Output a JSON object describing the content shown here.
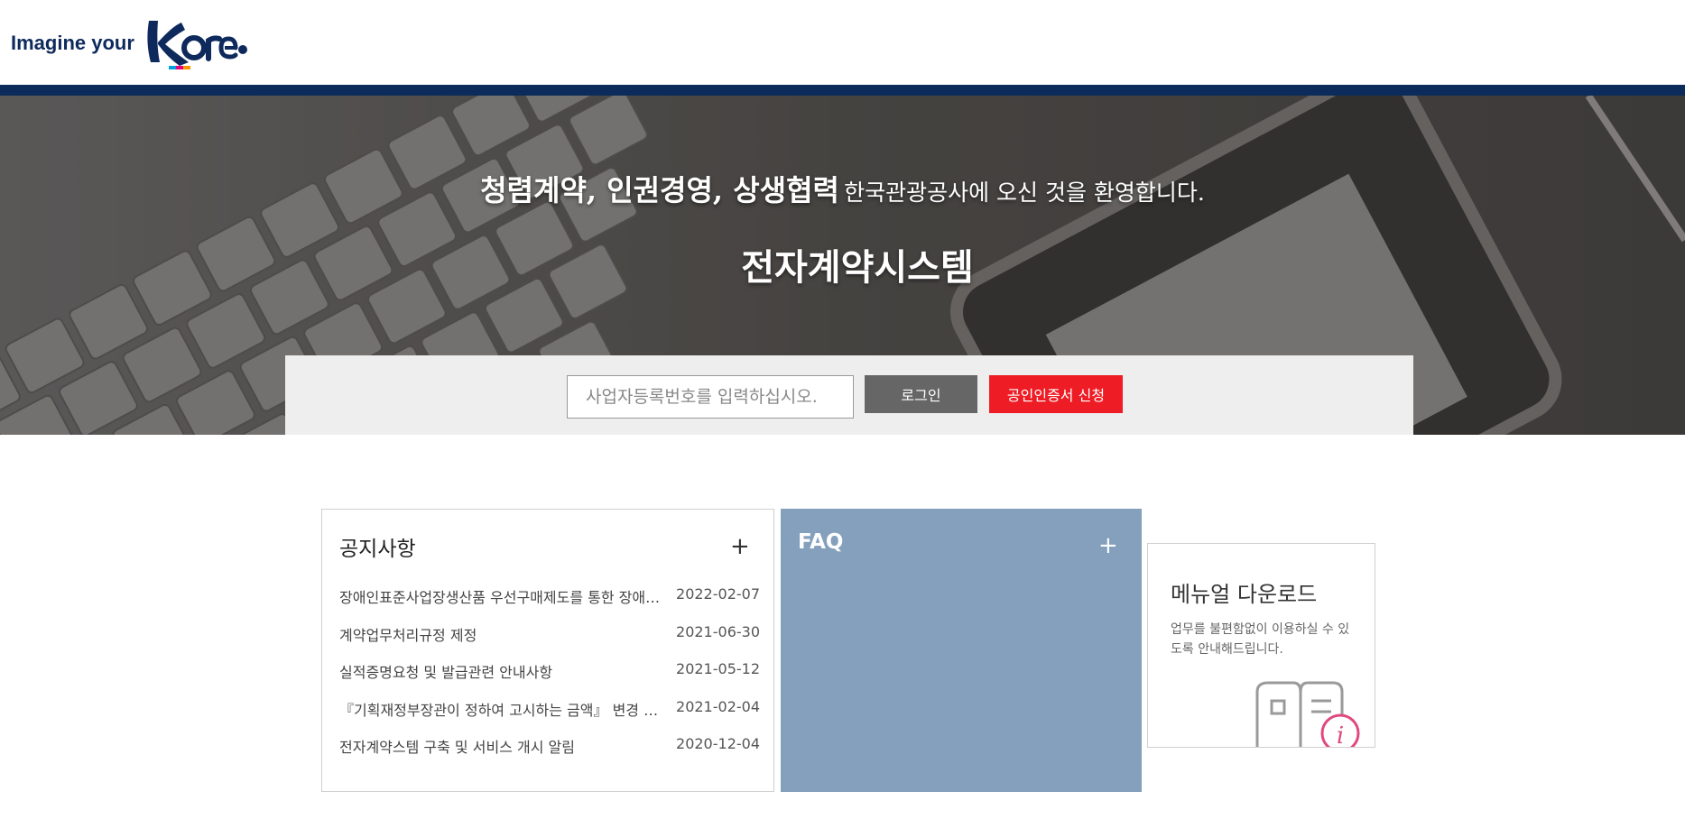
{
  "header": {
    "logo_text": "Imagine your",
    "logo_mark": "Korea"
  },
  "hero": {
    "welcome_strong": "청렴계약, 인권경영, 상생협력",
    "welcome_rest": "한국관광공사에 오신 것을 환영합니다.",
    "title": "전자계약시스템"
  },
  "login": {
    "placeholder": "사업자등록번호를 입력하십시오.",
    "login_label": "로그인",
    "cert_label": "공인인증서 신청"
  },
  "notice": {
    "title": "공지사항",
    "more": "+",
    "items": [
      {
        "title": "장애인표준사업장생산품 우선구매제도를 통한 장애인 고용 확대 안내",
        "date": "2022-02-07"
      },
      {
        "title": "계약업무처리규정 제정",
        "date": "2021-06-30"
      },
      {
        "title": "실적증명요청 및 발급관련 안내사항",
        "date": "2021-05-12"
      },
      {
        "title": "『기획재정부장관이 정하여 고시하는 금액』 변경 알림",
        "date": "2021-02-04"
      },
      {
        "title": "전자계약스템 구축 및 서비스 개시 알림",
        "date": "2020-12-04"
      }
    ]
  },
  "faq": {
    "title": "FAQ",
    "more": "+"
  },
  "manual": {
    "title": "메뉴얼 다운로드",
    "desc": "업무를 불편함없이 이용하실 수 있도록 안내해드립니다."
  },
  "colors": {
    "navy": "#0b2c5a",
    "login_button": "#666666",
    "cert_button": "#ee1c25",
    "faq_panel": "#84a0bc",
    "accent_pink": "#e0487f"
  },
  "icons": [
    "korea-logo-icon",
    "plus-icon",
    "manual-book-icon",
    "info-icon"
  ]
}
